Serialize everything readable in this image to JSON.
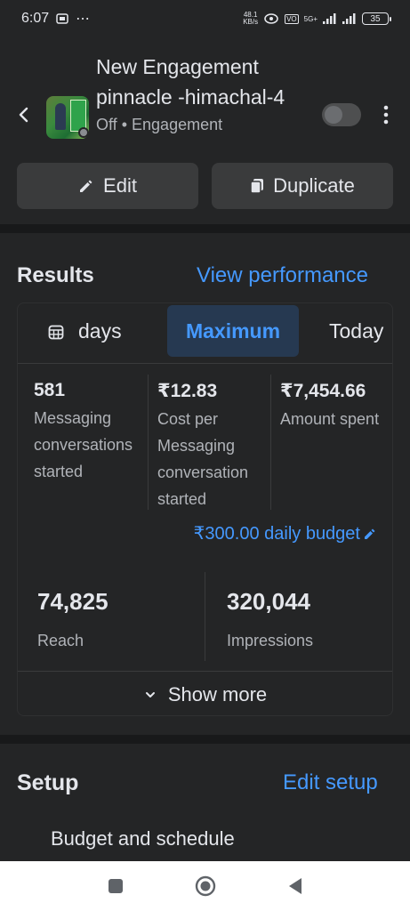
{
  "status_bar": {
    "time": "6:07",
    "net_speed_top": "48.1",
    "net_speed_bottom": "KB/s",
    "battery": "35",
    "network": "5G+"
  },
  "campaign": {
    "title_line1": "New Engagement",
    "title_line2": "pinnacle -himachal-4",
    "status": "Off",
    "separator": "•",
    "objective": "Engagement"
  },
  "actions": {
    "edit_label": "Edit",
    "duplicate_label": "Duplicate"
  },
  "results": {
    "title": "Results",
    "view_performance": "View performance",
    "date_tabs": {
      "days": "days",
      "maximum": "Maximum",
      "today": "Today",
      "selected": "Maximum"
    },
    "metrics": [
      {
        "value": "581",
        "label": "Messaging conversations started"
      },
      {
        "value": "₹12.83",
        "label": "Cost per Messaging conversation started"
      },
      {
        "value": "₹7,454.66",
        "label": "Amount spent"
      }
    ],
    "daily_budget": "₹300.00 daily budget",
    "reach": {
      "value": "74,825",
      "label": "Reach"
    },
    "impressions": {
      "value": "320,044",
      "label": "Impressions"
    },
    "show_more": "Show more"
  },
  "setup": {
    "title": "Setup",
    "edit_setup": "Edit setup",
    "first_item": "Budget and schedule"
  },
  "colors": {
    "background": "#242526",
    "accent": "#4599ff",
    "selected_tab_bg": "#263951"
  }
}
